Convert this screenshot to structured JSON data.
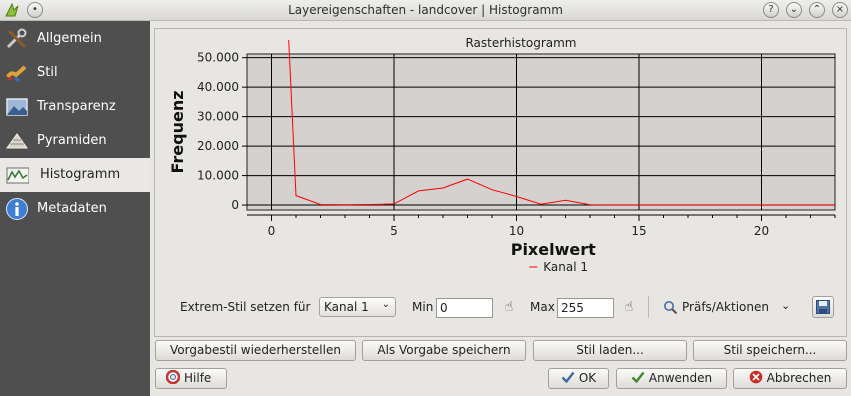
{
  "window": {
    "title": "Layereigenschaften - landcover | Histogramm",
    "buttons": [
      "?",
      "⌄",
      "⌃",
      "×"
    ]
  },
  "sidebar": {
    "items": [
      {
        "label": "Allgemein",
        "icon": "tools-icon"
      },
      {
        "label": "Stil",
        "icon": "brush-icon"
      },
      {
        "label": "Transparenz",
        "icon": "transparency-icon"
      },
      {
        "label": "Pyramiden",
        "icon": "pyramid-icon"
      },
      {
        "label": "Histogramm",
        "icon": "histogram-icon",
        "active": true
      },
      {
        "label": "Metadaten",
        "icon": "info-icon"
      }
    ]
  },
  "chart_data": {
    "type": "line",
    "title": "Rasterhistogramm",
    "xlabel": "Pixelwert",
    "ylabel": "Frequenz",
    "xlim": [
      -1,
      23
    ],
    "ylim": [
      -1000,
      56000
    ],
    "xticks": [
      0,
      5,
      10,
      15,
      20
    ],
    "yticks": [
      0,
      10000,
      20000,
      30000,
      40000,
      50000
    ],
    "ytick_labels": [
      "0",
      "10.000",
      "20.000",
      "30.000",
      "40.000",
      "50.000"
    ],
    "grid": true,
    "legend": "bottom-center",
    "series": [
      {
        "name": "Kanal 1",
        "color": "#ff0000",
        "x": [
          0.7,
          1,
          2,
          3,
          4,
          5,
          6,
          7,
          8,
          9,
          10,
          11,
          12,
          13,
          14,
          15,
          16,
          17,
          18,
          19,
          20,
          21,
          22,
          23
        ],
        "values": [
          56000,
          3200,
          200,
          100,
          200,
          400,
          4800,
          5800,
          8800,
          5200,
          2900,
          300,
          1600,
          100,
          50,
          50,
          50,
          50,
          50,
          50,
          50,
          50,
          50,
          50
        ]
      }
    ]
  },
  "controls": {
    "extrem_label": "Extrem-Stil setzen für",
    "channel_value": "Kanal 1",
    "min_label": "Min",
    "min_value": "0",
    "max_label": "Max",
    "max_value": "255",
    "prefs_label": "Präfs/Aktionen"
  },
  "buttons": {
    "restore_default": "Vorgabestil wiederherstellen",
    "save_default": "Als Vorgabe speichern",
    "load_style": "Stil laden...",
    "save_style": "Stil speichern...",
    "help": "Hilfe",
    "ok": "OK",
    "apply": "Anwenden",
    "cancel": "Abbrechen"
  },
  "colors": {
    "sidebar_bg": "#4f4f4f",
    "plot_bg": "#d4d1cf",
    "series_line": "#ff0000"
  }
}
